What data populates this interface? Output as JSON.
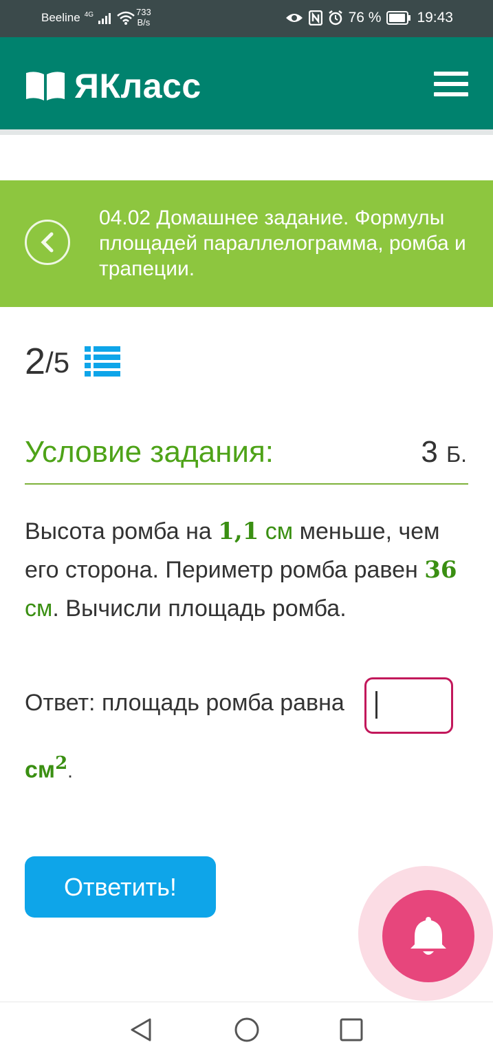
{
  "status_bar": {
    "carrier": "Beeline",
    "net_type": "4G",
    "speed_value": "733",
    "speed_unit": "B/s",
    "battery": "76 %",
    "time": "19:43"
  },
  "app_bar": {
    "logo_text": "ЯКласс"
  },
  "banner": {
    "title": "04.02 Домашнее задание. Формулы площадей параллелограмма, ромба и трапеции."
  },
  "progress": {
    "current": "2",
    "total": "/5"
  },
  "condition": {
    "title": "Условие задания:",
    "points_value": "3",
    "points_unit": "Б."
  },
  "task": {
    "part1": "Высота ромба на ",
    "num1": "1,1",
    "unit1": " см",
    "part2": " меньше, чем его сторона. Периметр ромба равен ",
    "num2": "36",
    "unit2": " см",
    "part3": ". Вычисли площадь ромба."
  },
  "answer": {
    "label": "Ответ: площадь ромба равна",
    "value": "",
    "unit": "см",
    "unit_power": "2",
    "end_dot": "."
  },
  "submit": {
    "label": "Ответить!"
  },
  "icons": {
    "back": "chevron-left-icon",
    "list": "list-icon",
    "bell": "bell-icon",
    "menu": "menu-icon"
  },
  "colors": {
    "app_bar": "#00826e",
    "banner": "#8dc63f",
    "accent_green": "#4ea318",
    "submit": "#0ea5e9",
    "input_border": "#c2185b",
    "bell": "#e7467c"
  }
}
